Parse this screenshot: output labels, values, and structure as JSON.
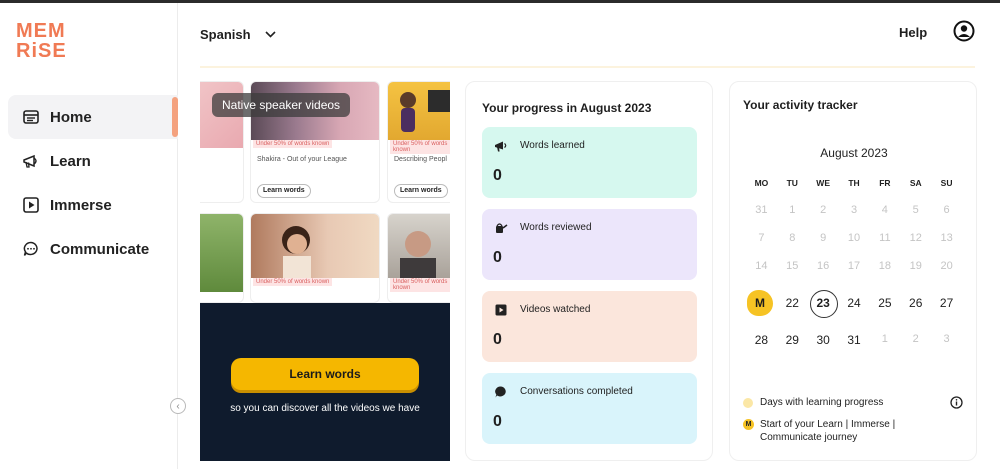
{
  "brand": {
    "logo_line1": "MEM",
    "logo_line2": "RiSE",
    "accent": "#f07a54"
  },
  "sidebar": {
    "items": [
      {
        "label": "Home",
        "icon": "home-icon",
        "active": true
      },
      {
        "label": "Learn",
        "icon": "learn-icon",
        "active": false
      },
      {
        "label": "Immerse",
        "icon": "play-icon",
        "active": false
      },
      {
        "label": "Communicate",
        "icon": "chat-icon",
        "active": false
      }
    ],
    "collapse_icon": "chevron-left-icon"
  },
  "header": {
    "language": "Spanish",
    "help": "Help",
    "profile_icon": "user-circle-icon"
  },
  "videos": {
    "overlay_label": "Native speaker videos",
    "cards": [
      {
        "tag": "Under 50% of words known",
        "title": "Shakira - Out of your League",
        "button": "Learn words"
      },
      {
        "tag": "Under 50% of words known",
        "title": "Describing Peopl",
        "button": "Learn words"
      },
      {
        "tag": "Under 50% of words known",
        "title": "",
        "button": ""
      },
      {
        "tag": "Under 50% of words known",
        "title": "",
        "button": ""
      }
    ],
    "cta_button": "Learn words",
    "cta_text": "so you can discover all the videos we have"
  },
  "progress": {
    "title": "Your progress in August 2023",
    "cards": [
      {
        "label": "Words learned",
        "value": "0",
        "color": "#d6f8ef",
        "icon": "megaphone-icon"
      },
      {
        "label": "Words reviewed",
        "value": "0",
        "color": "#ece6fb",
        "icon": "watering-can-icon"
      },
      {
        "label": "Videos watched",
        "value": "0",
        "color": "#fbe6dc",
        "icon": "video-icon"
      },
      {
        "label": "Conversations completed",
        "value": "0",
        "color": "#d9f4fb",
        "icon": "speech-bubble-icon"
      }
    ]
  },
  "tracker": {
    "title": "Your activity tracker",
    "month": "August 2023",
    "weekdays": [
      "MO",
      "TU",
      "WE",
      "TH",
      "FR",
      "SA",
      "SU"
    ],
    "weeks": [
      [
        "31",
        "1",
        "2",
        "3",
        "4",
        "5",
        "6"
      ],
      [
        "7",
        "8",
        "9",
        "10",
        "11",
        "12",
        "13"
      ],
      [
        "14",
        "15",
        "16",
        "17",
        "18",
        "19",
        "20"
      ],
      [
        "M",
        "22",
        "23",
        "24",
        "25",
        "26",
        "27"
      ],
      [
        "28",
        "29",
        "30",
        "31",
        "1",
        "2",
        "3"
      ]
    ],
    "today": "23",
    "legend_progress": "Days with learning progress",
    "legend_start": "Start of your Learn | Immerse | Communicate journey",
    "legend_start_mark": "M",
    "info_icon": "info-icon"
  }
}
